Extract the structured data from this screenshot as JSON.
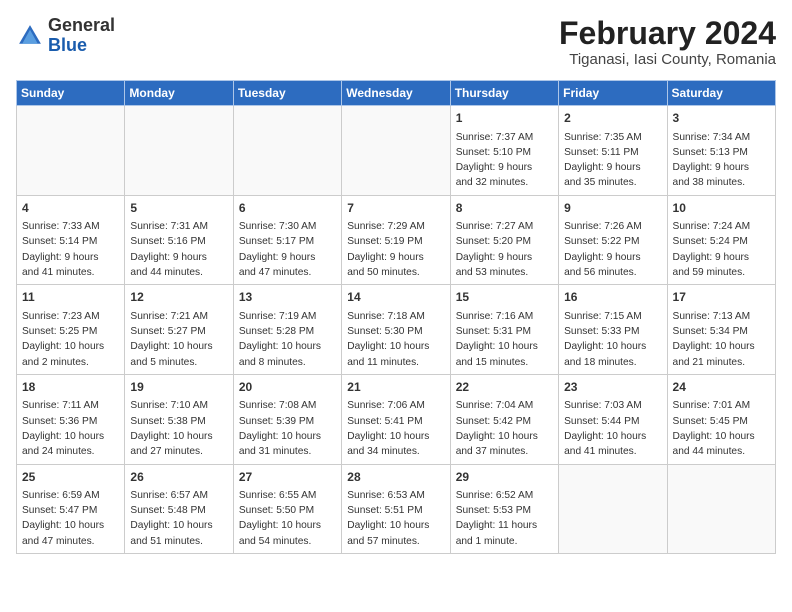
{
  "header": {
    "logo_general": "General",
    "logo_blue": "Blue",
    "title": "February 2024",
    "subtitle": "Tiganasi, Iasi County, Romania"
  },
  "calendar": {
    "days_of_week": [
      "Sunday",
      "Monday",
      "Tuesday",
      "Wednesday",
      "Thursday",
      "Friday",
      "Saturday"
    ],
    "weeks": [
      [
        {
          "day": "",
          "info": ""
        },
        {
          "day": "",
          "info": ""
        },
        {
          "day": "",
          "info": ""
        },
        {
          "day": "",
          "info": ""
        },
        {
          "day": "1",
          "info": "Sunrise: 7:37 AM\nSunset: 5:10 PM\nDaylight: 9 hours\nand 32 minutes."
        },
        {
          "day": "2",
          "info": "Sunrise: 7:35 AM\nSunset: 5:11 PM\nDaylight: 9 hours\nand 35 minutes."
        },
        {
          "day": "3",
          "info": "Sunrise: 7:34 AM\nSunset: 5:13 PM\nDaylight: 9 hours\nand 38 minutes."
        }
      ],
      [
        {
          "day": "4",
          "info": "Sunrise: 7:33 AM\nSunset: 5:14 PM\nDaylight: 9 hours\nand 41 minutes."
        },
        {
          "day": "5",
          "info": "Sunrise: 7:31 AM\nSunset: 5:16 PM\nDaylight: 9 hours\nand 44 minutes."
        },
        {
          "day": "6",
          "info": "Sunrise: 7:30 AM\nSunset: 5:17 PM\nDaylight: 9 hours\nand 47 minutes."
        },
        {
          "day": "7",
          "info": "Sunrise: 7:29 AM\nSunset: 5:19 PM\nDaylight: 9 hours\nand 50 minutes."
        },
        {
          "day": "8",
          "info": "Sunrise: 7:27 AM\nSunset: 5:20 PM\nDaylight: 9 hours\nand 53 minutes."
        },
        {
          "day": "9",
          "info": "Sunrise: 7:26 AM\nSunset: 5:22 PM\nDaylight: 9 hours\nand 56 minutes."
        },
        {
          "day": "10",
          "info": "Sunrise: 7:24 AM\nSunset: 5:24 PM\nDaylight: 9 hours\nand 59 minutes."
        }
      ],
      [
        {
          "day": "11",
          "info": "Sunrise: 7:23 AM\nSunset: 5:25 PM\nDaylight: 10 hours\nand 2 minutes."
        },
        {
          "day": "12",
          "info": "Sunrise: 7:21 AM\nSunset: 5:27 PM\nDaylight: 10 hours\nand 5 minutes."
        },
        {
          "day": "13",
          "info": "Sunrise: 7:19 AM\nSunset: 5:28 PM\nDaylight: 10 hours\nand 8 minutes."
        },
        {
          "day": "14",
          "info": "Sunrise: 7:18 AM\nSunset: 5:30 PM\nDaylight: 10 hours\nand 11 minutes."
        },
        {
          "day": "15",
          "info": "Sunrise: 7:16 AM\nSunset: 5:31 PM\nDaylight: 10 hours\nand 15 minutes."
        },
        {
          "day": "16",
          "info": "Sunrise: 7:15 AM\nSunset: 5:33 PM\nDaylight: 10 hours\nand 18 minutes."
        },
        {
          "day": "17",
          "info": "Sunrise: 7:13 AM\nSunset: 5:34 PM\nDaylight: 10 hours\nand 21 minutes."
        }
      ],
      [
        {
          "day": "18",
          "info": "Sunrise: 7:11 AM\nSunset: 5:36 PM\nDaylight: 10 hours\nand 24 minutes."
        },
        {
          "day": "19",
          "info": "Sunrise: 7:10 AM\nSunset: 5:38 PM\nDaylight: 10 hours\nand 27 minutes."
        },
        {
          "day": "20",
          "info": "Sunrise: 7:08 AM\nSunset: 5:39 PM\nDaylight: 10 hours\nand 31 minutes."
        },
        {
          "day": "21",
          "info": "Sunrise: 7:06 AM\nSunset: 5:41 PM\nDaylight: 10 hours\nand 34 minutes."
        },
        {
          "day": "22",
          "info": "Sunrise: 7:04 AM\nSunset: 5:42 PM\nDaylight: 10 hours\nand 37 minutes."
        },
        {
          "day": "23",
          "info": "Sunrise: 7:03 AM\nSunset: 5:44 PM\nDaylight: 10 hours\nand 41 minutes."
        },
        {
          "day": "24",
          "info": "Sunrise: 7:01 AM\nSunset: 5:45 PM\nDaylight: 10 hours\nand 44 minutes."
        }
      ],
      [
        {
          "day": "25",
          "info": "Sunrise: 6:59 AM\nSunset: 5:47 PM\nDaylight: 10 hours\nand 47 minutes."
        },
        {
          "day": "26",
          "info": "Sunrise: 6:57 AM\nSunset: 5:48 PM\nDaylight: 10 hours\nand 51 minutes."
        },
        {
          "day": "27",
          "info": "Sunrise: 6:55 AM\nSunset: 5:50 PM\nDaylight: 10 hours\nand 54 minutes."
        },
        {
          "day": "28",
          "info": "Sunrise: 6:53 AM\nSunset: 5:51 PM\nDaylight: 10 hours\nand 57 minutes."
        },
        {
          "day": "29",
          "info": "Sunrise: 6:52 AM\nSunset: 5:53 PM\nDaylight: 11 hours\nand 1 minute."
        },
        {
          "day": "",
          "info": ""
        },
        {
          "day": "",
          "info": ""
        }
      ]
    ]
  }
}
